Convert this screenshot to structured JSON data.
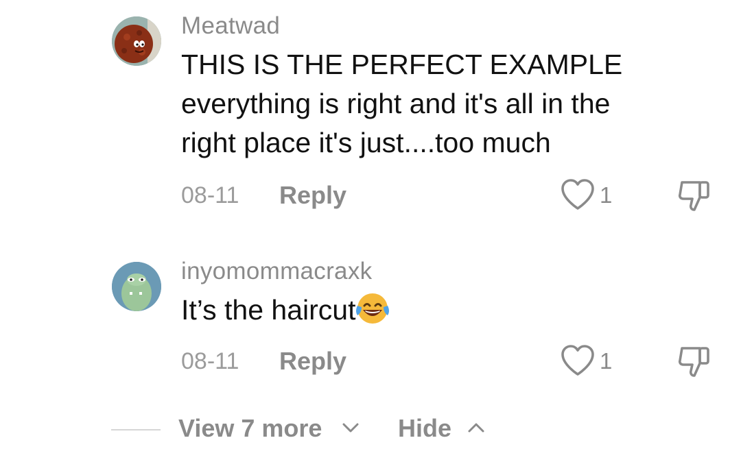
{
  "comments": [
    {
      "username": "Meatwad",
      "text_lines": [
        "THIS IS THE PERFECT EXAMPLE",
        "everything is right and it's all in the",
        "right place it's just....too much"
      ],
      "date": "08-11",
      "reply_label": "Reply",
      "like_count": "1",
      "avatar_icon": "meatwad-avatar",
      "like_icon": "heart-outline-icon",
      "dislike_icon": "thumbs-down-icon"
    },
    {
      "username": "inyomommacraxk",
      "text": "It’s the haircut",
      "emoji_icon": "face-with-tears-of-joy-emoji",
      "date": "08-11",
      "reply_label": "Reply",
      "like_count": "1",
      "avatar_icon": "green-character-avatar",
      "like_icon": "heart-outline-icon",
      "dislike_icon": "thumbs-down-icon"
    }
  ],
  "footer": {
    "view_more_label": "View 7 more",
    "hide_label": "Hide",
    "view_more_icon": "chevron-down-icon",
    "hide_icon": "chevron-up-icon"
  },
  "colors": {
    "text_primary": "#111111",
    "text_secondary": "#8a8a8a",
    "divider": "#d6d6d6"
  }
}
